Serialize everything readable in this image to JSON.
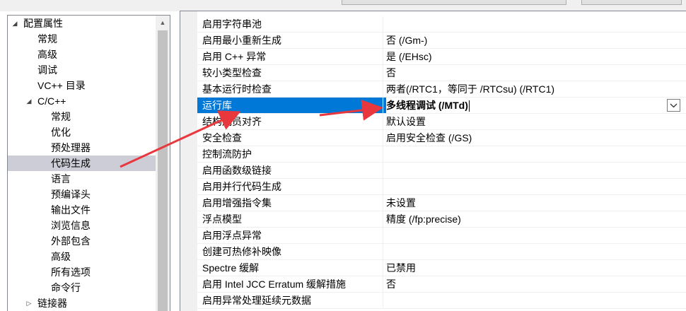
{
  "tree": {
    "items": [
      {
        "label": "配置属性",
        "level": 0,
        "toggle": "expanded"
      },
      {
        "label": "常规",
        "level": 1
      },
      {
        "label": "高级",
        "level": 1
      },
      {
        "label": "调试",
        "level": 1
      },
      {
        "label": "VC++ 目录",
        "level": 1
      },
      {
        "label": "C/C++",
        "level": 1,
        "toggle": "expanded"
      },
      {
        "label": "常规",
        "level": 2
      },
      {
        "label": "优化",
        "level": 2
      },
      {
        "label": "预处理器",
        "level": 2
      },
      {
        "label": "代码生成",
        "level": 2,
        "selected": true
      },
      {
        "label": "语言",
        "level": 2
      },
      {
        "label": "预编译头",
        "level": 2
      },
      {
        "label": "输出文件",
        "level": 2
      },
      {
        "label": "浏览信息",
        "level": 2
      },
      {
        "label": "外部包含",
        "level": 2
      },
      {
        "label": "高级",
        "level": 2
      },
      {
        "label": "所有选项",
        "level": 2
      },
      {
        "label": "命令行",
        "level": 2
      },
      {
        "label": "链接器",
        "level": 1,
        "toggle": "collapsed"
      }
    ]
  },
  "properties": [
    {
      "name": "启用字符串池",
      "value": ""
    },
    {
      "name": "启用最小重新生成",
      "value": "否 (/Gm-)"
    },
    {
      "name": "启用 C++ 异常",
      "value": "是 (/EHsc)"
    },
    {
      "name": "较小类型检查",
      "value": "否"
    },
    {
      "name": "基本运行时检查",
      "value": "两者(/RTC1，等同于 /RTCsu) (/RTC1)"
    },
    {
      "name": "运行库",
      "value": "多线程调试 (/MTd)",
      "selected": true
    },
    {
      "name": "结构成员对齐",
      "value": "默认设置"
    },
    {
      "name": "安全检查",
      "value": "启用安全检查 (/GS)"
    },
    {
      "name": "控制流防护",
      "value": ""
    },
    {
      "name": "启用函数级链接",
      "value": ""
    },
    {
      "name": "启用并行代码生成",
      "value": ""
    },
    {
      "name": "启用增强指令集",
      "value": "未设置"
    },
    {
      "name": "浮点模型",
      "value": "精度 (/fp:precise)"
    },
    {
      "name": "启用浮点异常",
      "value": ""
    },
    {
      "name": "创建可热修补映像",
      "value": ""
    },
    {
      "name": "Spectre 缓解",
      "value": "已禁用"
    },
    {
      "name": "启用 Intel JCC Erratum 缓解措施",
      "value": "否"
    },
    {
      "name": "启用异常处理延续元数据",
      "value": ""
    }
  ],
  "colors": {
    "selection_blue": "#0078d7",
    "tree_selection": "#cdcdd7",
    "annotation_arrow": "#e8383d"
  },
  "icons": {
    "expanded": "expanded-triangle-icon",
    "collapsed": "collapsed-triangle-icon",
    "dropdown": "chevron-down-icon"
  }
}
